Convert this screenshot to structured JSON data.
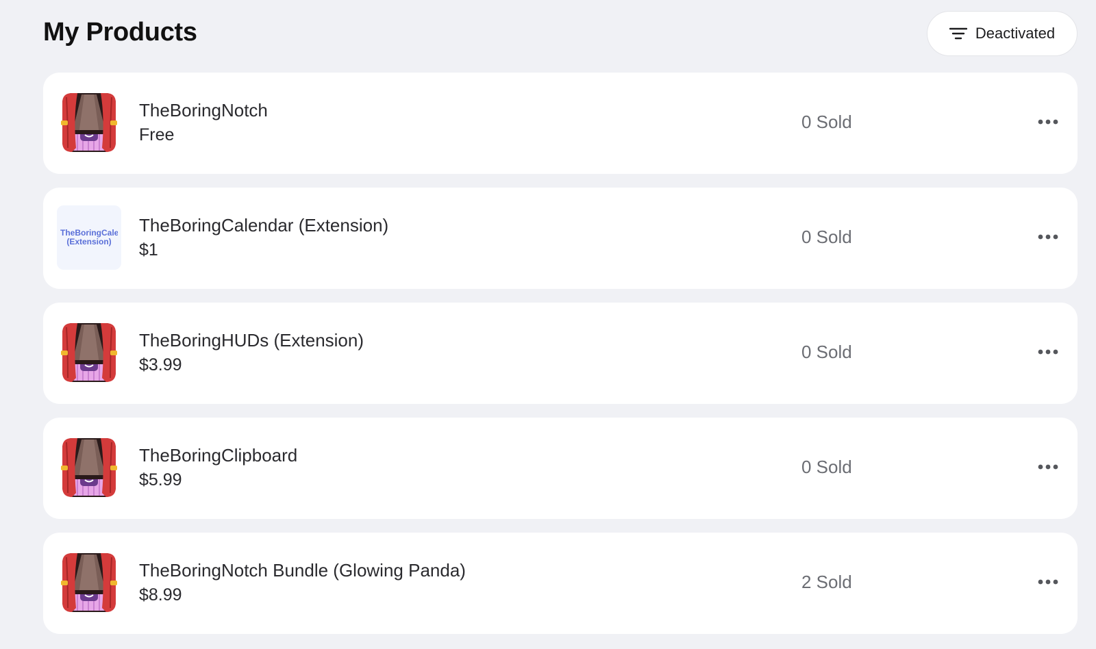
{
  "header": {
    "title": "My Products",
    "filter_label": "Deactivated",
    "filter_icon": "filter-lines-icon"
  },
  "products": [
    {
      "name": "TheBoringNotch",
      "price": "Free",
      "sold": "0 Sold",
      "thumbnail": "app-icon"
    },
    {
      "name": "TheBoringCalendar (Extension)",
      "price": "$1",
      "sold": "0 Sold",
      "thumbnail": "text-thumbnail",
      "thumbnail_text": [
        "TheBoringCalendar",
        "(Extension)"
      ]
    },
    {
      "name": "TheBoringHUDs (Extension)",
      "price": "$3.99",
      "sold": "0 Sold",
      "thumbnail": "app-icon"
    },
    {
      "name": "TheBoringClipboard",
      "price": "$5.99",
      "sold": "0 Sold",
      "thumbnail": "app-icon"
    },
    {
      "name": "TheBoringNotch Bundle (Glowing Panda)",
      "price": "$8.99",
      "sold": "2 Sold",
      "thumbnail": "app-icon"
    }
  ],
  "row_menu_icon": "more-horizontal-icon",
  "colors": {
    "background": "#f0f1f5",
    "card": "#ffffff",
    "sold_text": "#6b6d73",
    "thumbnail_text": "#5a6fd8"
  }
}
